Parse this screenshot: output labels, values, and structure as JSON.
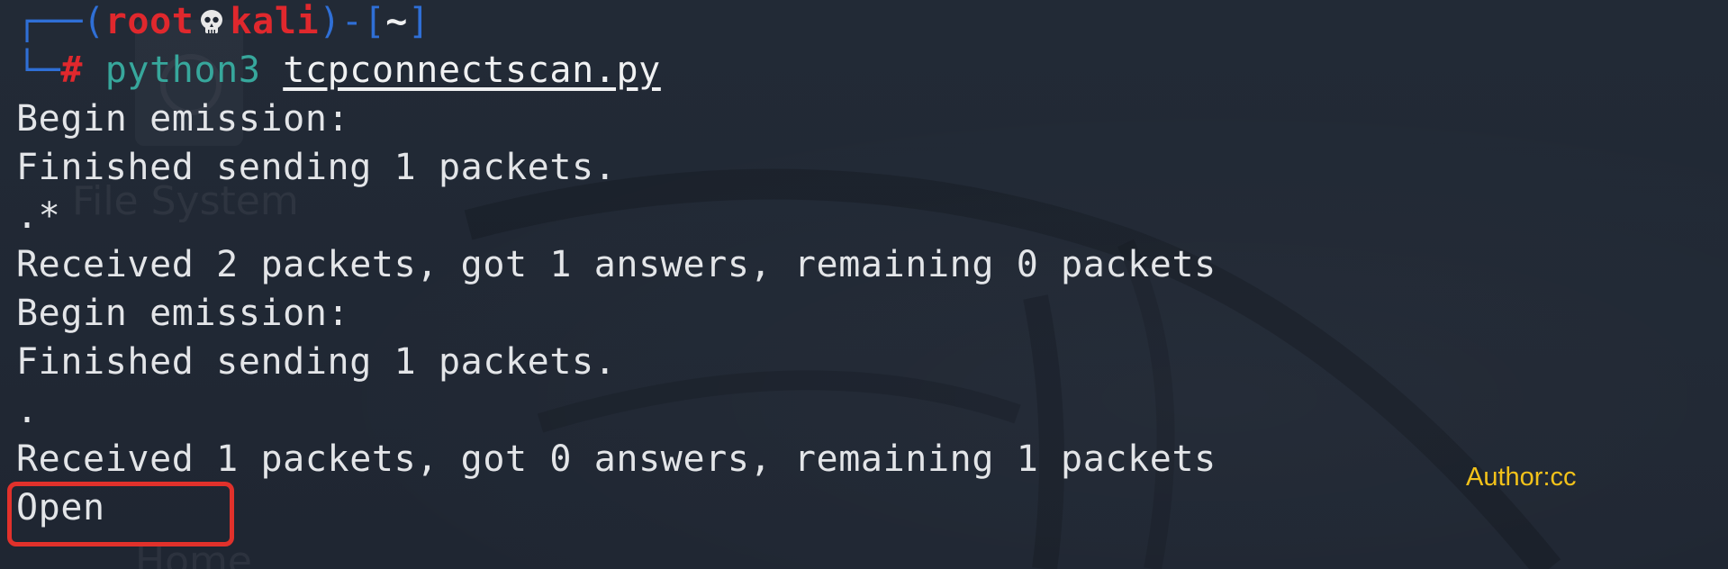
{
  "prompt": {
    "open_paren": "┌──(",
    "user": "root",
    "host": "kali",
    "close_dash": ")-[",
    "cwd": "~",
    "close_bracket": "]",
    "line2_prefix": "└─",
    "hash": "#",
    "command": "python3",
    "argument": "tcpconnectscan.py",
    "skull_icon": "skull-icon"
  },
  "output": [
    "Begin emission:",
    "Finished sending 1 packets.",
    ".*",
    "Received 2 packets, got 1 answers, remaining 0 packets",
    "Begin emission:",
    "Finished sending 1 packets.",
    ".",
    "Received 1 packets, got 0 answers, remaining 1 packets",
    "Open"
  ],
  "watermark": {
    "author": "Author:cc"
  },
  "background_labels": {
    "file_system": "File System",
    "home": "Home"
  },
  "colors": {
    "background": "#202733",
    "prompt_frame": "#2f6fd6",
    "prompt_user": "#e0282d",
    "command": "#37a79c",
    "highlight": "#e1312b",
    "author": "#f2c21a"
  }
}
